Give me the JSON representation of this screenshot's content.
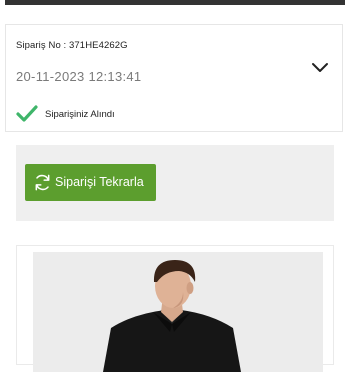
{
  "order": {
    "number_label": "Sipariş No : 371HE4262G",
    "datetime": "20-11-2023 12:13:41",
    "status": "Siparişiniz Alındı",
    "expand_icon": "chevron-down-icon",
    "status_icon": "checkmark-icon"
  },
  "actions": {
    "reorder_label": "Siparişi Tekrarla",
    "reorder_icon": "refresh-icon"
  },
  "colors": {
    "accent_green": "#5c9e2e",
    "check_green": "#3fb56a",
    "panel_gray": "#efefef",
    "date_gray": "#7a7a7a"
  },
  "product": {
    "image": "product-photo-man-in-black-shirt"
  }
}
